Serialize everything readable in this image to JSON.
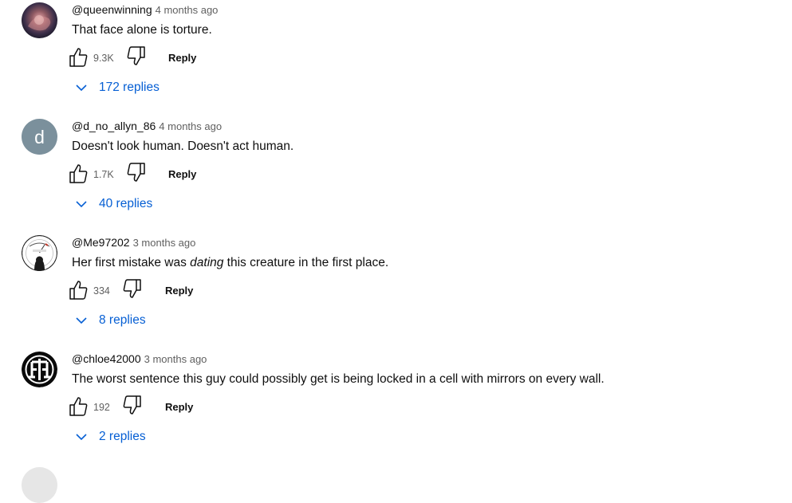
{
  "comments": [
    {
      "author": "@queenwinning",
      "time": "4 months ago",
      "text_parts": [
        "That face alone is torture.",
        "",
        ""
      ],
      "likes": "9.3K",
      "reply_label": "Reply",
      "replies_label": "172 replies",
      "avatar": "photo-avatar"
    },
    {
      "author": "@d_no_allyn_86",
      "time": "4 months ago",
      "text_parts": [
        "Doesn't look human. Doesn't act human.",
        "",
        ""
      ],
      "likes": "1.7K",
      "reply_label": "Reply",
      "replies_label": "40 replies",
      "avatar_letter": "d",
      "avatar_color": "#7b909c"
    },
    {
      "author": "@Me97202",
      "time": "3 months ago",
      "text_parts": [
        "Her first mistake was ",
        "dating",
        " this creature in the first place."
      ],
      "likes": "334",
      "reply_label": "Reply",
      "replies_label": "8 replies",
      "avatar": "gauge-avatar"
    },
    {
      "author": "@chloe42000",
      "time": "3 months ago",
      "text_parts": [
        "The worst sentence this guy could possibly get is being locked in a cell with mirrors on every wall.",
        "",
        ""
      ],
      "likes": "192",
      "reply_label": "Reply",
      "replies_label": "2 replies",
      "avatar": "logo-avatar"
    }
  ],
  "icons": {
    "like": "thumbs-up-icon",
    "dislike": "thumbs-down-icon",
    "expand": "chevron-down-icon"
  },
  "colors": {
    "link": "#065fd4",
    "secondary_text": "#606060"
  }
}
